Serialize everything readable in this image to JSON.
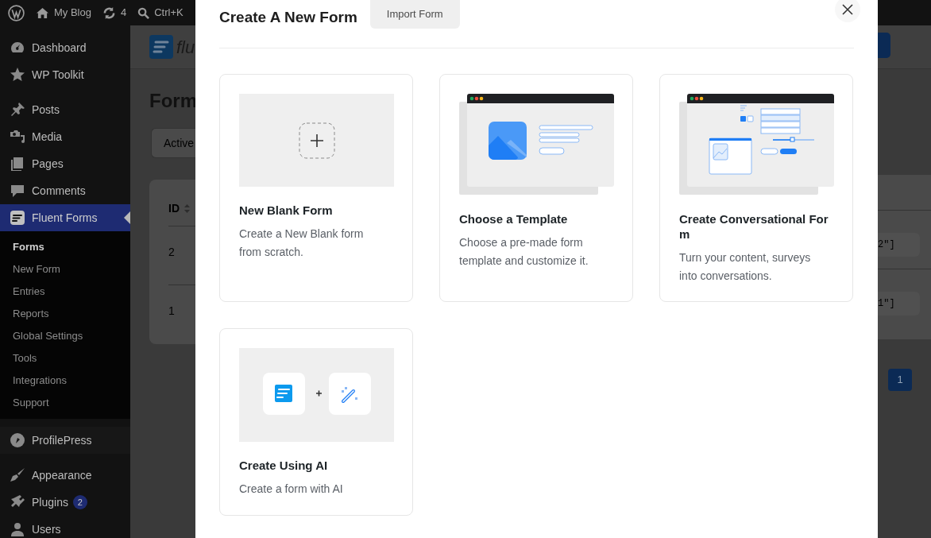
{
  "admin_bar": {
    "site": "My Blog",
    "updates": "4",
    "search": "Ctrl+K"
  },
  "sidebar": {
    "groups": [
      {
        "items": [
          {
            "label": "Dashboard",
            "selected": false
          },
          {
            "label": "WP Toolkit",
            "selected": false
          }
        ]
      },
      {
        "items": [
          {
            "label": "Posts",
            "selected": false
          },
          {
            "label": "Media",
            "selected": false
          },
          {
            "label": "Pages",
            "selected": false
          },
          {
            "label": "Comments",
            "selected": false
          },
          {
            "label": "Fluent Forms",
            "selected": true,
            "children": [
              {
                "label": "Forms",
                "selected": true
              },
              {
                "label": "New Form",
                "selected": false
              },
              {
                "label": "Entries",
                "selected": false
              },
              {
                "label": "Reports",
                "selected": false
              },
              {
                "label": "Global Settings",
                "selected": false
              },
              {
                "label": "Tools",
                "selected": false
              },
              {
                "label": "Integrations",
                "selected": false
              },
              {
                "label": "Support",
                "selected": false
              }
            ]
          }
        ]
      },
      {
        "items": [
          {
            "label": "ProfilePress",
            "selected": false
          }
        ]
      },
      {
        "items": [
          {
            "label": "Appearance",
            "selected": false
          },
          {
            "label": "Plugins",
            "selected": false,
            "badge": "2"
          },
          {
            "label": "Users",
            "selected": false
          }
        ]
      }
    ]
  },
  "background_page": {
    "logo_text": "flu",
    "heading": "Form",
    "filter_button": "Active",
    "table": {
      "columns": [
        "ID"
      ],
      "rows": [
        [
          "2"
        ],
        [
          "1"
        ]
      ]
    },
    "right_cells": [
      "2\"]",
      "1\"]"
    ],
    "pagination": {
      "current": "1"
    }
  },
  "modal": {
    "title": "Create A New Form",
    "import_button": "Import Form",
    "options": [
      {
        "kind": "blank",
        "title": "New Blank Form",
        "description": "Create a New Blank form from scratch."
      },
      {
        "kind": "template",
        "title": "Choose a Template",
        "description": "Choose a pre-made form template and customize it."
      },
      {
        "kind": "conversational",
        "title": "Create Conversational Form",
        "description": "Turn your content, surveys into conversations."
      },
      {
        "kind": "ai",
        "title": "Create Using AI",
        "description": "Create a form with AI"
      }
    ]
  }
}
